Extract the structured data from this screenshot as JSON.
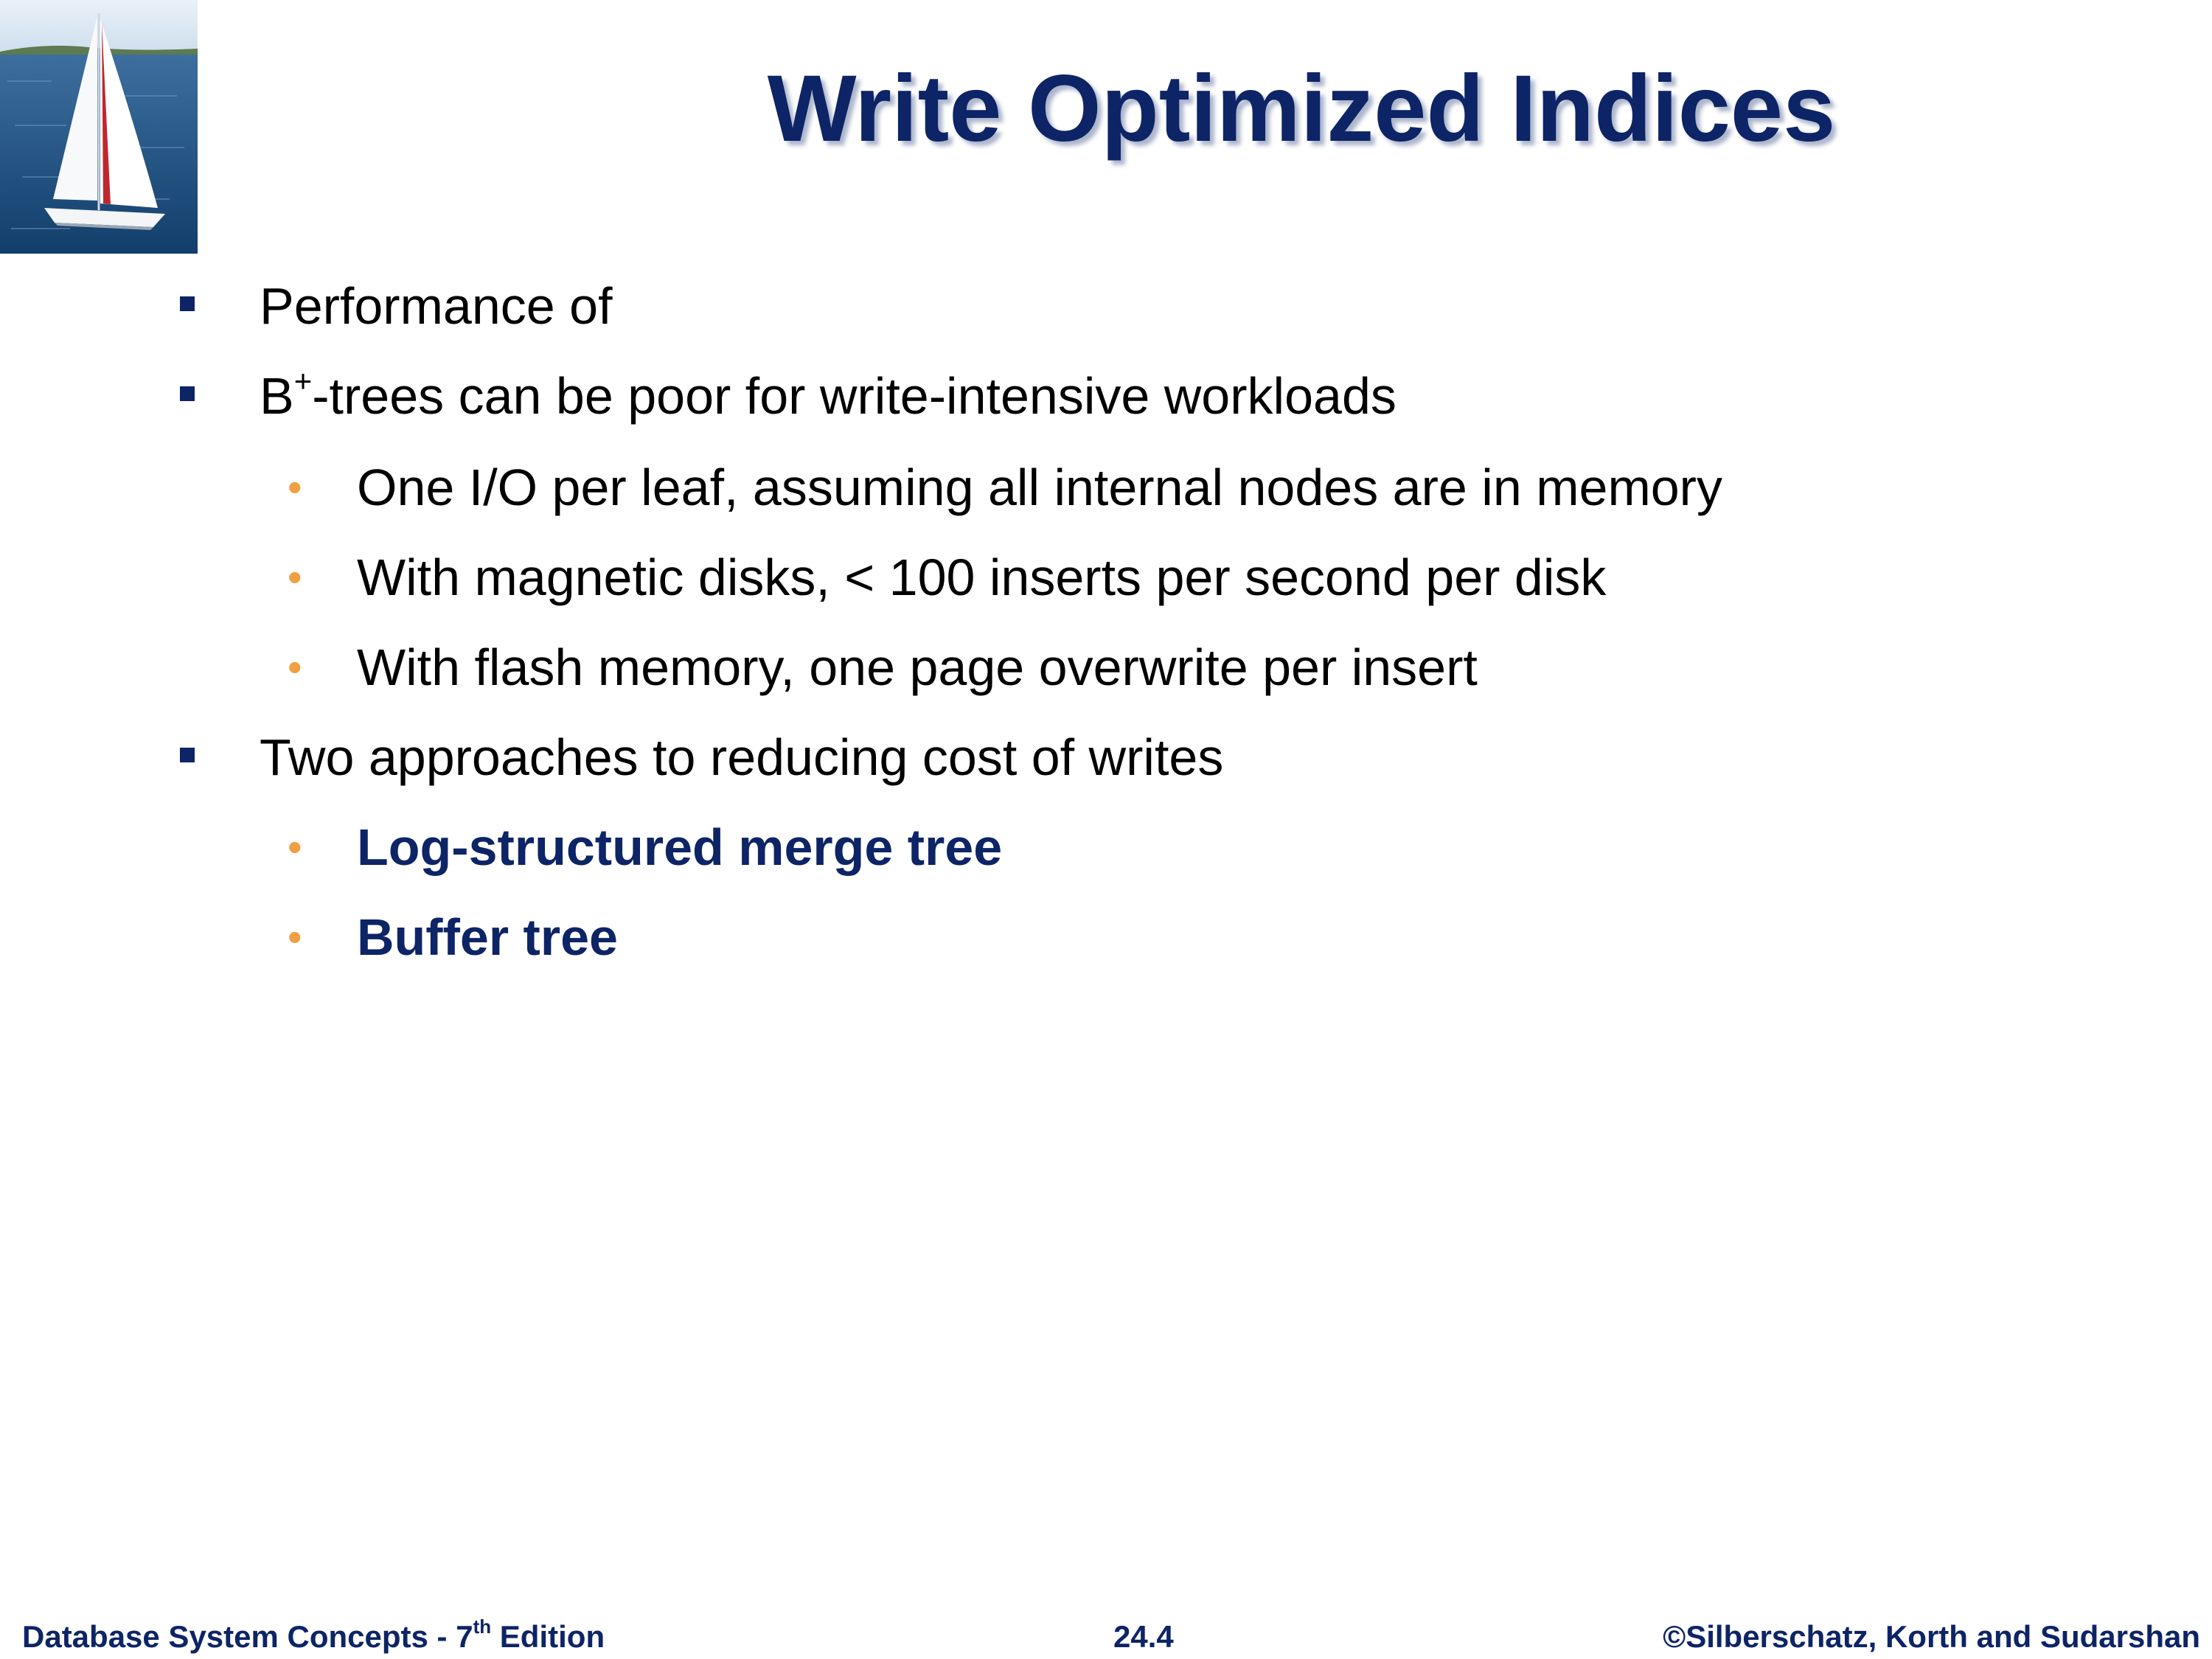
{
  "slide": {
    "title": "Write Optimized Indices",
    "bullets": [
      {
        "level": 1,
        "text": "Performance of"
      },
      {
        "level": 1,
        "text_pre": "B",
        "text_sup": "+",
        "text_post": "-trees can be poor for write-intensive workloads"
      },
      {
        "level": 2,
        "text": "One I/O per leaf, assuming all internal nodes are in memory"
      },
      {
        "level": 2,
        "text": "With magnetic disks, < 100 inserts per second per disk"
      },
      {
        "level": 2,
        "text": "With flash memory, one page overwrite per insert"
      },
      {
        "level": 1,
        "text": "Two approaches to reducing cost of writes"
      },
      {
        "level": 2,
        "text": "Log-structured merge tree",
        "emphasis": "bold"
      },
      {
        "level": 2,
        "text": "Buffer tree",
        "emphasis": "bold"
      }
    ],
    "bullet_glyph_level2": "•"
  },
  "footer": {
    "left_pre": "Database System Concepts - 7",
    "left_sup": "th",
    "left_post": " Edition",
    "center": "24.4",
    "right": "©Silberschatz, Korth and Sudarshan"
  },
  "colors": {
    "title": "#0d2466",
    "level1_bullet": "#0d2466",
    "level2_bullet": "#f0a042",
    "emphasis_text": "#0d2466",
    "footer_text": "#0d2466"
  },
  "logo": {
    "icon": "sailboat-photo-icon"
  }
}
